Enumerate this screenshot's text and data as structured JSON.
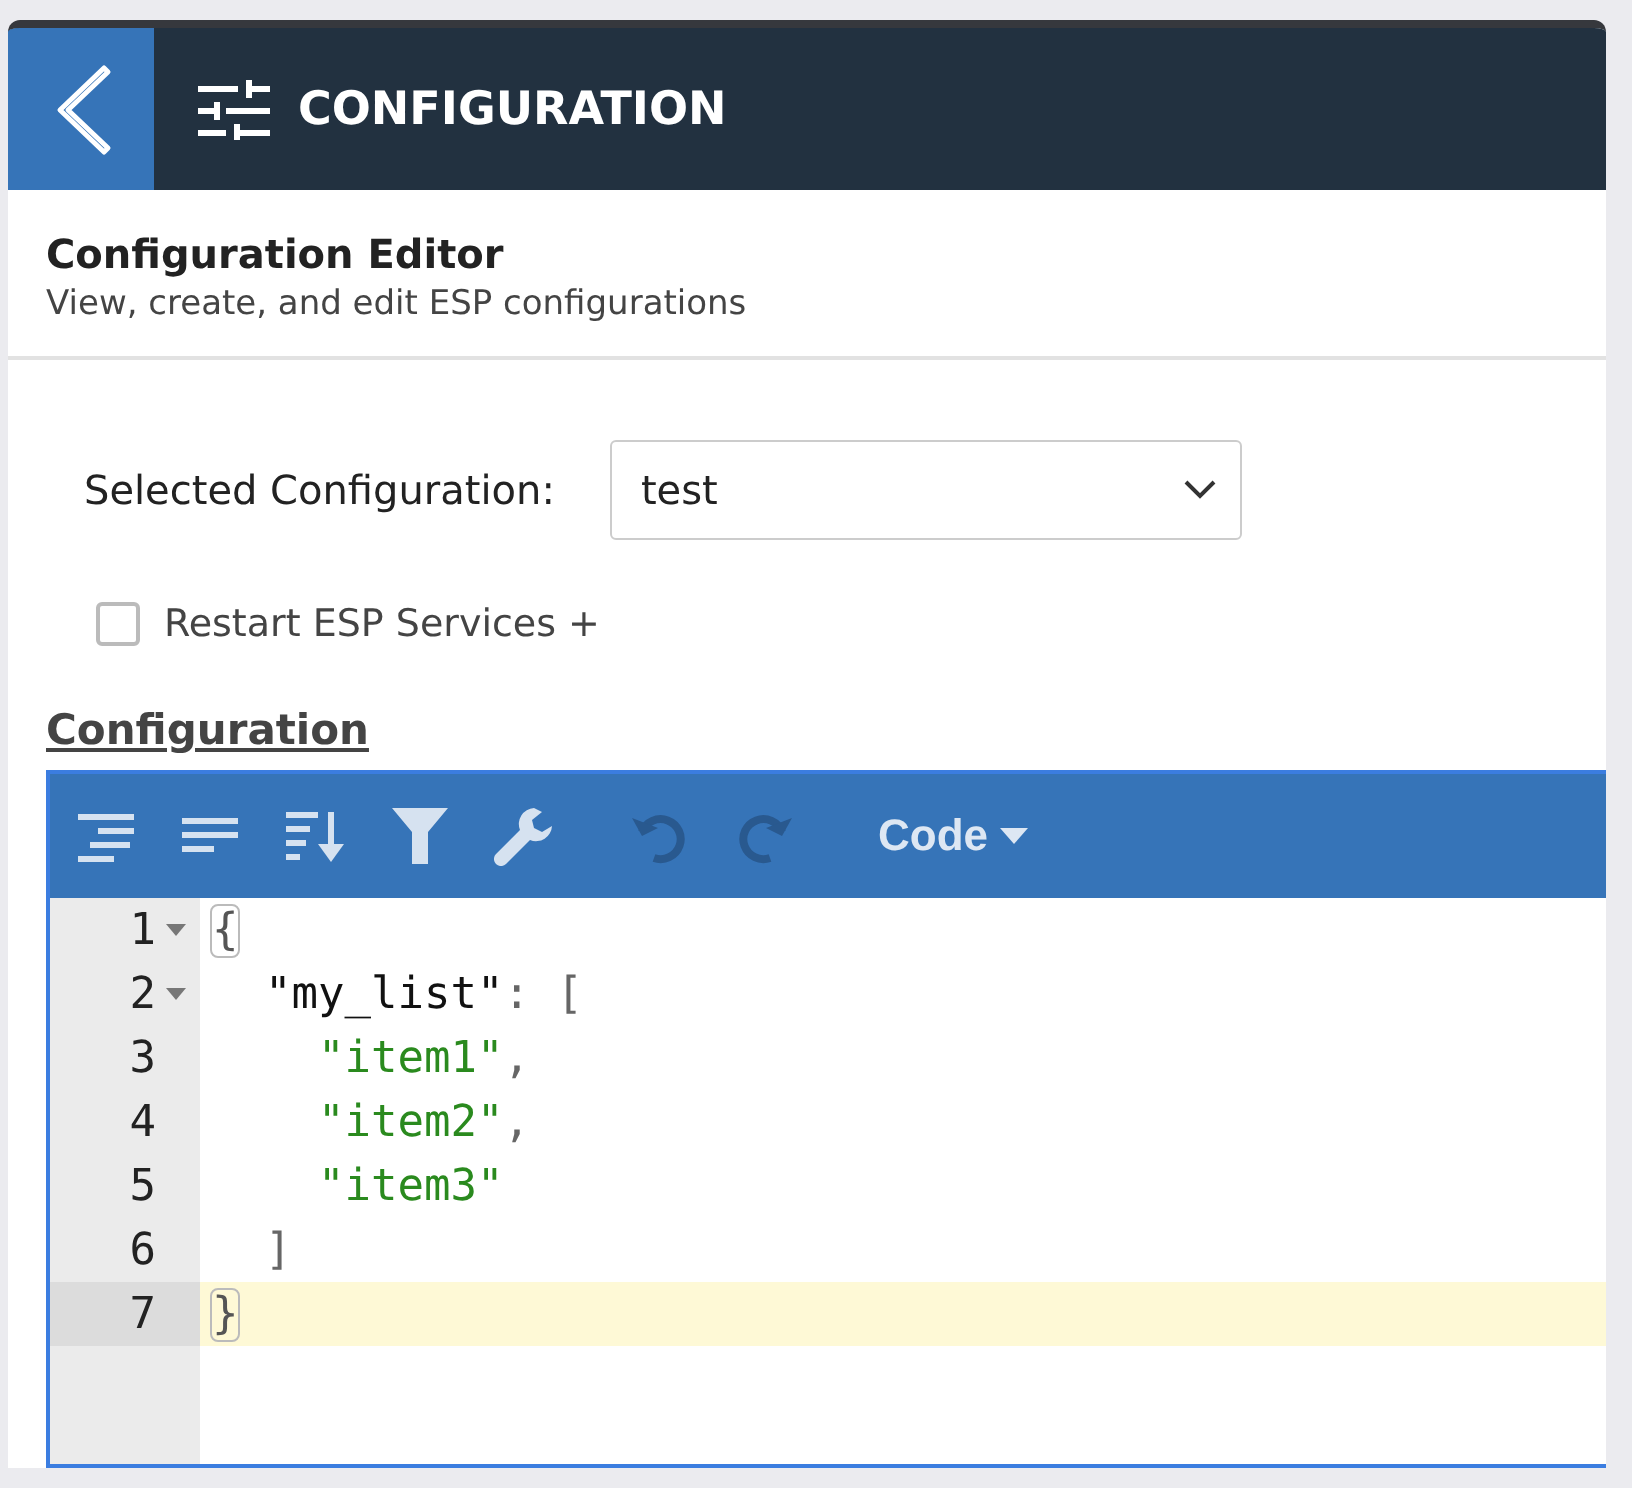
{
  "header": {
    "title": "CONFIGURATION"
  },
  "intro": {
    "title": "Configuration Editor",
    "subtitle": "View, create, and edit ESP configurations"
  },
  "selector": {
    "label": "Selected Configuration:",
    "value": "test"
  },
  "restart": {
    "label": "Restart ESP Services +",
    "checked": false
  },
  "section_title": "Configuration",
  "toolbar": {
    "tools": [
      {
        "kind": "format",
        "disabled": false
      },
      {
        "kind": "compact",
        "disabled": false
      },
      {
        "kind": "sort",
        "disabled": false
      },
      {
        "kind": "filter",
        "disabled": false
      },
      {
        "kind": "repair",
        "disabled": false
      },
      {
        "kind": "undo",
        "disabled": true
      },
      {
        "kind": "redo",
        "disabled": true
      }
    ],
    "mode": "Code"
  },
  "lines": [
    {
      "number": "1",
      "foldable": true,
      "active": false,
      "tokens": [
        {
          "kind": "bracket",
          "text": "{"
        }
      ]
    },
    {
      "number": "2",
      "foldable": true,
      "active": false,
      "tokens": [
        {
          "kind": "key",
          "text": "  \"my_list\""
        },
        {
          "kind": "punct",
          "text": ": "
        },
        {
          "kind": "punct",
          "text": "["
        }
      ]
    },
    {
      "number": "3",
      "foldable": false,
      "active": false,
      "tokens": [
        {
          "kind": "string",
          "text": "    \"item1\""
        },
        {
          "kind": "punct",
          "text": ","
        }
      ]
    },
    {
      "number": "4",
      "foldable": false,
      "active": false,
      "tokens": [
        {
          "kind": "string",
          "text": "    \"item2\""
        },
        {
          "kind": "punct",
          "text": ","
        }
      ]
    },
    {
      "number": "5",
      "foldable": false,
      "active": false,
      "tokens": [
        {
          "kind": "string",
          "text": "    \"item3\""
        }
      ]
    },
    {
      "number": "6",
      "foldable": false,
      "active": false,
      "tokens": [
        {
          "kind": "punct",
          "text": "  ]"
        }
      ]
    },
    {
      "number": "7",
      "foldable": false,
      "active": true,
      "tokens": [
        {
          "kind": "bracket",
          "text": "}"
        }
      ]
    }
  ]
}
